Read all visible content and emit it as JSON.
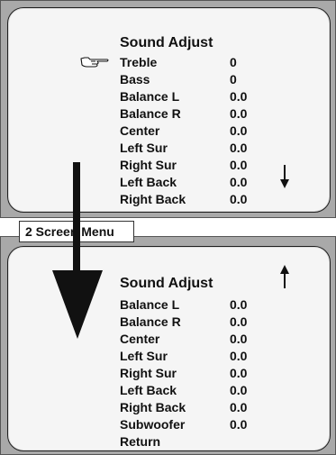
{
  "top_screen": {
    "title": "Sound Adjust",
    "items": [
      {
        "label": "Treble",
        "value": "0"
      },
      {
        "label": "Bass",
        "value": "0"
      },
      {
        "label": "Balance L",
        "value": "0.0"
      },
      {
        "label": "Balance R",
        "value": "0.0"
      },
      {
        "label": "Center",
        "value": "0.0"
      },
      {
        "label": "Left Sur",
        "value": "0.0"
      },
      {
        "label": "Right Sur",
        "value": "0.0"
      },
      {
        "label": "Left Back",
        "value": "0.0"
      },
      {
        "label": "Right Back",
        "value": "0.0"
      }
    ],
    "pointer_icon": "pointing-hand-icon",
    "scroll_icon": "down-arrow-icon"
  },
  "caption": "2 Screen Menu",
  "bottom_screen": {
    "title": "Sound Adjust",
    "items": [
      {
        "label": "Balance L",
        "value": "0.0"
      },
      {
        "label": "Balance R",
        "value": "0.0"
      },
      {
        "label": "Center",
        "value": "0.0"
      },
      {
        "label": "Left Sur",
        "value": "0.0"
      },
      {
        "label": "Right Sur",
        "value": "0.0"
      },
      {
        "label": "Left Back",
        "value": "0.0"
      },
      {
        "label": "Right Back",
        "value": "0.0"
      },
      {
        "label": "Subwoofer",
        "value": "0.0"
      },
      {
        "label": "Return",
        "value": ""
      }
    ],
    "scroll_icon": "up-arrow-icon"
  },
  "transition_icon": "long-down-arrow-icon"
}
